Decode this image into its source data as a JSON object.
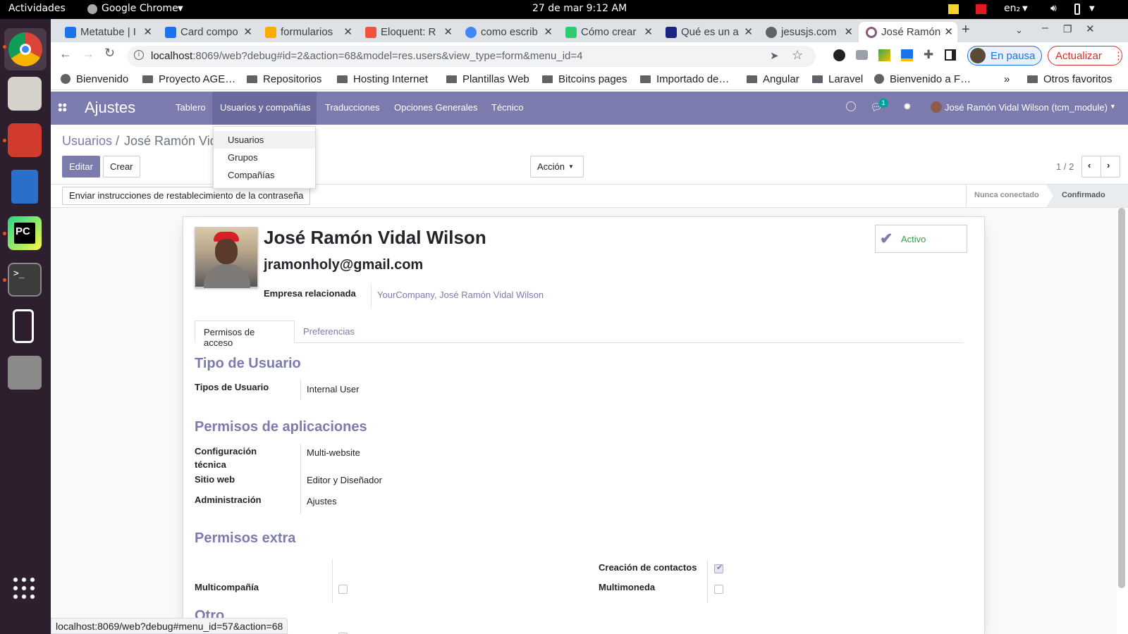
{
  "system": {
    "activities": "Actividades",
    "app_name": "Google Chrome",
    "clock": "27 de mar  9:12 AM",
    "lang": "en₂"
  },
  "tabs": [
    {
      "title": "Metatube | I",
      "color": "#1a73e8"
    },
    {
      "title": "Card compo",
      "color": "#1a73e8"
    },
    {
      "title": "formularios",
      "color": "#f9ab00"
    },
    {
      "title": "Eloquent: R",
      "color": "#f05340"
    },
    {
      "title": "como escrib",
      "color": "#4285f4"
    },
    {
      "title": "Cómo crear",
      "color": "#2ecc71"
    },
    {
      "title": "Qué es un a",
      "color": "#1a237e"
    },
    {
      "title": "jesusjs.com",
      "color": "#5f6368"
    },
    {
      "title": "José Ramón",
      "color": "#875a7b"
    }
  ],
  "browser": {
    "url_host": "localhost",
    "url_rest": ":8069/web?debug#id=2&action=68&model=res.users&view_type=form&menu_id=4",
    "profile": "En pausa",
    "update": "Actualizar",
    "status_url": "localhost:8069/web?debug#menu_id=57&action=68"
  },
  "bookmarks": {
    "items": [
      "Bienvenido",
      "Proyecto AGE…",
      "Repositorios",
      "Hosting Internet",
      "Plantillas Web",
      "Bitcoins pages",
      "Importado de…",
      "Angular",
      "Laravel",
      "Bienvenido a F…"
    ],
    "more": "»",
    "others": "Otros favoritos"
  },
  "nav": {
    "app": "Ajustes",
    "menus": [
      "Tablero",
      "Usuarios y compañías",
      "Traducciones",
      "Opciones Generales",
      "Técnico"
    ],
    "chat_count": "1",
    "user": "José Ramón Vidal Wilson (tcm_module)"
  },
  "dropdown": [
    "Usuarios",
    "Grupos",
    "Compañías"
  ],
  "control_panel": {
    "breadcrumb_parent": "Usuarios",
    "breadcrumb_sep": "/",
    "breadcrumb_current": "José Ramón Vid",
    "edit": "Editar",
    "create": "Crear",
    "action": "Acción",
    "pager": "1 / 2"
  },
  "statusbar": {
    "reset_button": "Enviar instrucciones de restablecimiento de la contraseña",
    "states": [
      "Nunca conectado",
      "Confirmado"
    ]
  },
  "form": {
    "name": "José Ramón Vidal Wilson",
    "email": "jramonholy@gmail.com",
    "related_company_label": "Empresa relacionada",
    "related_company_value": "YourCompany, José Ramón Vidal Wilson",
    "active_label": "Activo",
    "tabs": [
      "Permisos de acceso",
      "Preferencias"
    ],
    "section_user_type": "Tipo de Usuario",
    "user_type_label": "Tipos de Usuario",
    "user_type_value": "Internal User",
    "section_app_perms": "Permisos de aplicaciones",
    "tech_config_label_1": "Configuración",
    "tech_config_label_2": "técnica",
    "tech_config_value": "Multi-website",
    "website_label": "Sitio web",
    "website_value": "Editor y Diseñador",
    "admin_label": "Administración",
    "admin_value": "Ajustes",
    "section_extra": "Permisos extra",
    "contact_creation_label": "Creación de contactos",
    "contact_creation_checked": true,
    "multicompany_label": "Multicompañía",
    "multicompany_checked": false,
    "multicurrency_label": "Multimoneda",
    "multicurrency_checked": false,
    "section_other": "Otro"
  },
  "colors": {
    "odoo_primary": "#7c7bad",
    "dock_bg": "#2e1f2e",
    "chrome_update": "#d93025"
  }
}
